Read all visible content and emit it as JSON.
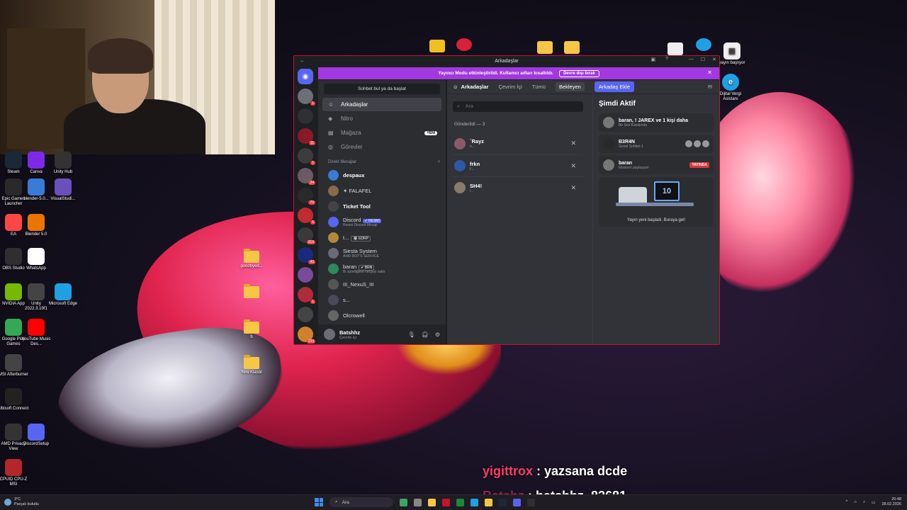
{
  "webcam": {
    "label": ""
  },
  "desktop_icons": [
    {
      "name": "Steam",
      "icon": "steam-icon",
      "color": "#1b2838"
    },
    {
      "name": "Canva",
      "icon": "canva-icon",
      "color": "#7d2ae8"
    },
    {
      "name": "Unity Hub",
      "icon": "unity-hub-icon",
      "color": "#333333"
    },
    {
      "name": "Epic Games Launcher",
      "icon": "epic-games-icon",
      "color": "#2a2a2a"
    },
    {
      "name": "blender-5.0...",
      "icon": "installer-icon",
      "color": "#3a7bd5"
    },
    {
      "name": "VisualStudi...",
      "icon": "visual-studio-icon",
      "color": "#6b4fbb"
    },
    {
      "name": "EA",
      "icon": "ea-icon",
      "color": "#ff4747"
    },
    {
      "name": "Blender 5.0",
      "icon": "blender-icon",
      "color": "#ea7600"
    },
    {
      "name": "OBS Studio",
      "icon": "obs-icon",
      "color": "#302e31"
    },
    {
      "name": "WhatsApp",
      "icon": "document-icon",
      "color": "#ffffff"
    },
    {
      "name": "NVIDIA App",
      "icon": "nvidia-icon",
      "color": "#76b900"
    },
    {
      "name": "Unity 2022.3.19f1",
      "icon": "unity-icon",
      "color": "#444444"
    },
    {
      "name": "Microsoft Edge",
      "icon": "edge-icon",
      "color": "#1fa0e3"
    },
    {
      "name": "Google Play Games",
      "icon": "play-games-icon",
      "color": "#34a853"
    },
    {
      "name": "YouTube Music Des...",
      "icon": "youtube-music-icon",
      "color": "#ff0000"
    },
    {
      "name": "MSI Afterburner",
      "icon": "afterburner-icon",
      "color": "#444444"
    },
    {
      "name": "Ubisoft Connect",
      "icon": "ubisoft-icon",
      "color": "#222222"
    },
    {
      "name": "AMD Privacy View",
      "icon": "amd-icon",
      "color": "#333333"
    },
    {
      "name": "DiscordSetup",
      "icon": "discord-icon",
      "color": "#5865f2"
    },
    {
      "name": "CPUID CPU-Z MSI",
      "icon": "cpuz-icon",
      "color": "#b3262b"
    }
  ],
  "desktop_right_icons": [
    {
      "name": "yayın başlıyor",
      "icon": "app-icon"
    },
    {
      "name": "Dijital Vergi Asistanı",
      "icon": "edge-icon"
    }
  ],
  "desktop_folders": [
    {
      "name": "goodbyed..."
    },
    {
      "name": ""
    },
    {
      "name": "b"
    },
    {
      "name": "Yeni Klasör"
    }
  ],
  "discord": {
    "window_title": "Arkadaşlar",
    "banner": {
      "text": "Yayıncı Modu etkinleştirildi. Kullanıcı adları kısaltıldı.",
      "button": "Devre dışı bırak"
    },
    "dm_search_placeholder": "Sohbet bul ya da başlat",
    "nav": [
      {
        "label": "Arkadaşlar",
        "icon": "friends-icon",
        "active": true
      },
      {
        "label": "Nitro",
        "icon": "nitro-icon"
      },
      {
        "label": "Mağaza",
        "icon": "shop-icon",
        "badge": "YENİ"
      },
      {
        "label": "Görevler",
        "icon": "quests-icon"
      }
    ],
    "dm_header": "Direkt Mesajlar",
    "dm_add": "+",
    "dms": [
      {
        "name": "despaux",
        "sub": "",
        "bold": true
      },
      {
        "name": "✶ FALAFEL",
        "sub": ""
      },
      {
        "name": "Ticket Tool",
        "sub": "",
        "bold": true
      },
      {
        "name": "Discord",
        "tag": "✔ RESMİ",
        "sub": "Resmi Discord Mesajı"
      },
      {
        "name": "t...",
        "tag": "🏵 EDRP",
        "sub": ""
      },
      {
        "name": "Siesta System",
        "sub": "ANKI BOT'S SERVICE"
      },
      {
        "name": "baran",
        "tag": "✔ BRN",
        "sub": "Bi sürelliğime herşeyi saldı"
      },
      {
        "name": "III_NexuS_III",
        "sub": ""
      },
      {
        "name": "s...",
        "sub": ""
      },
      {
        "name": "Olcrowell",
        "sub": ""
      }
    ],
    "user": {
      "name": "Batshhz",
      "status": "Çevrim içi"
    },
    "tabs": {
      "title": "Arkadaşlar",
      "online": "Çevrim İçi",
      "all": "Tümü",
      "pending": "Bekleyen",
      "add": "Arkadaş Ekle"
    },
    "friends_search_placeholder": "Ara",
    "pending_label": "Gönderildi — 3",
    "pending": [
      {
        "name": "`Rayz",
        "sub": "o..."
      },
      {
        "name": "frkn",
        "sub": "f..."
      },
      {
        "name": "SH4!",
        "sub": "i..."
      }
    ],
    "active_now": {
      "title": "Şimdi Aktif",
      "cards": [
        {
          "name": "baran, ! JAREX ve 1 kişi daha",
          "sub": "Bir Ses Kanalında"
        },
        {
          "name": "B3R4N",
          "sub": "Genel Sohbet 1"
        },
        {
          "name": "baran",
          "sub": "Ekranını paylaşıyor",
          "live": "YAYINDA"
        }
      ],
      "stream_screen": "10",
      "stream_caption": "Yayın yeni başladı. Buraya gel!"
    }
  },
  "chat": [
    {
      "user": "yigittrox",
      "message": " : yazsana dcde"
    },
    {
      "user": "Batshz",
      "message": " : batshhz_83681"
    }
  ],
  "taskbar": {
    "weather_temp": "3°C",
    "weather_text": "Parçalı bulutlu",
    "search": "Ara",
    "time": "20:48",
    "date": "28.02.2026"
  }
}
